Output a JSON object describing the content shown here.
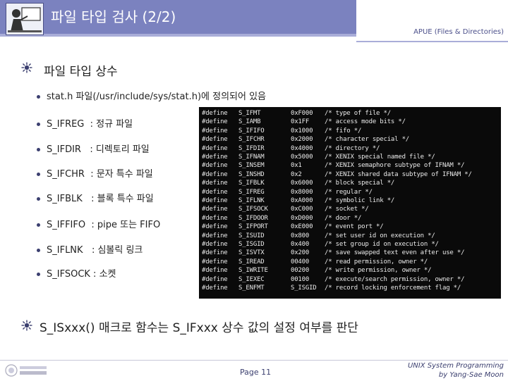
{
  "header": {
    "title": "파일 타입 검사 (2/2)",
    "subtitle": "APUE (Files & Directories)"
  },
  "section1": {
    "title": "파일 타입 상수",
    "items": [
      "stat.h 파일(/usr/include/sys/stat.h)에 정의되어 있음",
      "S_IFREG  : 정규 파일",
      "S_IFDIR   : 디렉토리 파일",
      "S_IFCHR  : 문자 특수 파일",
      "S_IFBLK   : 블록 특수 파일",
      "S_IFFIFO  : pipe 또는 FIFO",
      "S_IFLNK   : 심볼릭 링크",
      "S_IFSOCK : 소켓"
    ]
  },
  "code": [
    {
      "def": "#define",
      "name": "S_IFMT",
      "val": "0xF000",
      "cmt": "/* type of file */"
    },
    {
      "def": "#define",
      "name": "S_IAMB",
      "val": "0x1FF",
      "cmt": "/* access mode bits */"
    },
    {
      "def": "#define",
      "name": "S_IFIFO",
      "val": "0x1000",
      "cmt": "/* fifo */"
    },
    {
      "def": "#define",
      "name": "S_IFCHR",
      "val": "0x2000",
      "cmt": "/* character special */"
    },
    {
      "def": "#define",
      "name": "S_IFDIR",
      "val": "0x4000",
      "cmt": "/* directory */"
    },
    {
      "def": "#define",
      "name": "S_IFNAM",
      "val": "0x5000",
      "cmt": "/* XENIX special named file */"
    },
    {
      "def": "#define",
      "name": "S_INSEM",
      "val": "0x1",
      "cmt": "/* XENIX semaphore subtype of IFNAM */"
    },
    {
      "def": "#define",
      "name": "S_INSHD",
      "val": "0x2",
      "cmt": "/* XENIX shared data subtype of IFNAM */"
    },
    {
      "def": "#define",
      "name": "S_IFBLK",
      "val": "0x6000",
      "cmt": "/* block special */"
    },
    {
      "def": "#define",
      "name": "S_IFREG",
      "val": "0x8000",
      "cmt": "/* regular */"
    },
    {
      "def": "#define",
      "name": "S_IFLNK",
      "val": "0xA000",
      "cmt": "/* symbolic link */"
    },
    {
      "def": "#define",
      "name": "S_IFSOCK",
      "val": "0xC000",
      "cmt": "/* socket */"
    },
    {
      "def": "#define",
      "name": "S_IFDOOR",
      "val": "0xD000",
      "cmt": "/* door */"
    },
    {
      "def": "#define",
      "name": "S_IFPORT",
      "val": "0xE000",
      "cmt": "/* event port */"
    },
    {
      "def": "#define",
      "name": "S_ISUID",
      "val": "0x800",
      "cmt": "/* set user id on execution */"
    },
    {
      "def": "#define",
      "name": "S_ISGID",
      "val": "0x400",
      "cmt": "/* set group id on execution */"
    },
    {
      "def": "#define",
      "name": "S_ISVTX",
      "val": "0x200",
      "cmt": "/* save swapped text even after use */"
    },
    {
      "def": "#define",
      "name": "S_IREAD",
      "val": "00400",
      "cmt": "/* read permission, owner */"
    },
    {
      "def": "#define",
      "name": "S_IWRITE",
      "val": "00200",
      "cmt": "/* write permission, owner */"
    },
    {
      "def": "#define",
      "name": "S_IEXEC",
      "val": "00100",
      "cmt": "/* execute/search permission, owner */"
    },
    {
      "def": "#define",
      "name": "S_ENFMT",
      "val": "S_ISGID",
      "cmt": "/* record locking enforcement flag */"
    }
  ],
  "section2": {
    "title": "S_ISxxx() 매크로 함수는 S_IFxxx 상수 값의 설정 여부를 판단"
  },
  "footer": {
    "page": "Page 11",
    "credit_line1": "UNIX System Programming",
    "credit_line2": "by Yang-Sae Moon"
  },
  "colors": {
    "header_band": "#7b82bf",
    "accent": "#3b3f6f"
  }
}
